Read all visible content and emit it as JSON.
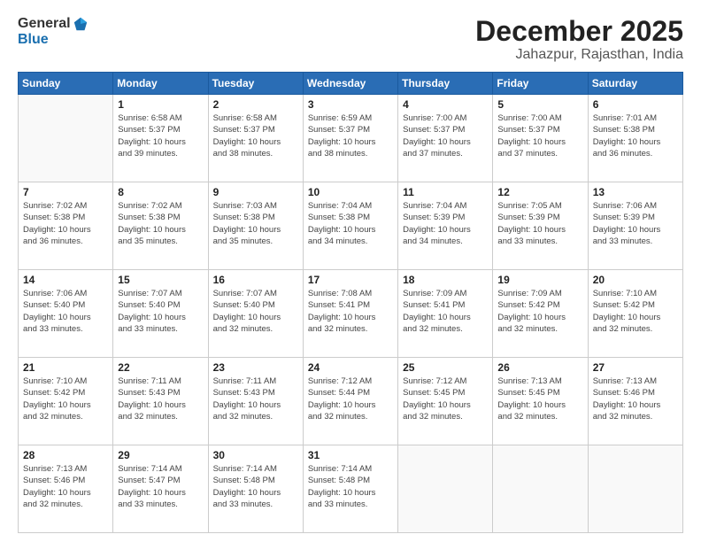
{
  "header": {
    "logo_general": "General",
    "logo_blue": "Blue",
    "month_title": "December 2025",
    "location": "Jahazpur, Rajasthan, India"
  },
  "days_of_week": [
    "Sunday",
    "Monday",
    "Tuesday",
    "Wednesday",
    "Thursday",
    "Friday",
    "Saturday"
  ],
  "weeks": [
    [
      {
        "day": "",
        "info": ""
      },
      {
        "day": "1",
        "info": "Sunrise: 6:58 AM\nSunset: 5:37 PM\nDaylight: 10 hours\nand 39 minutes."
      },
      {
        "day": "2",
        "info": "Sunrise: 6:58 AM\nSunset: 5:37 PM\nDaylight: 10 hours\nand 38 minutes."
      },
      {
        "day": "3",
        "info": "Sunrise: 6:59 AM\nSunset: 5:37 PM\nDaylight: 10 hours\nand 38 minutes."
      },
      {
        "day": "4",
        "info": "Sunrise: 7:00 AM\nSunset: 5:37 PM\nDaylight: 10 hours\nand 37 minutes."
      },
      {
        "day": "5",
        "info": "Sunrise: 7:00 AM\nSunset: 5:37 PM\nDaylight: 10 hours\nand 37 minutes."
      },
      {
        "day": "6",
        "info": "Sunrise: 7:01 AM\nSunset: 5:38 PM\nDaylight: 10 hours\nand 36 minutes."
      }
    ],
    [
      {
        "day": "7",
        "info": "Sunrise: 7:02 AM\nSunset: 5:38 PM\nDaylight: 10 hours\nand 36 minutes."
      },
      {
        "day": "8",
        "info": "Sunrise: 7:02 AM\nSunset: 5:38 PM\nDaylight: 10 hours\nand 35 minutes."
      },
      {
        "day": "9",
        "info": "Sunrise: 7:03 AM\nSunset: 5:38 PM\nDaylight: 10 hours\nand 35 minutes."
      },
      {
        "day": "10",
        "info": "Sunrise: 7:04 AM\nSunset: 5:38 PM\nDaylight: 10 hours\nand 34 minutes."
      },
      {
        "day": "11",
        "info": "Sunrise: 7:04 AM\nSunset: 5:39 PM\nDaylight: 10 hours\nand 34 minutes."
      },
      {
        "day": "12",
        "info": "Sunrise: 7:05 AM\nSunset: 5:39 PM\nDaylight: 10 hours\nand 33 minutes."
      },
      {
        "day": "13",
        "info": "Sunrise: 7:06 AM\nSunset: 5:39 PM\nDaylight: 10 hours\nand 33 minutes."
      }
    ],
    [
      {
        "day": "14",
        "info": "Sunrise: 7:06 AM\nSunset: 5:40 PM\nDaylight: 10 hours\nand 33 minutes."
      },
      {
        "day": "15",
        "info": "Sunrise: 7:07 AM\nSunset: 5:40 PM\nDaylight: 10 hours\nand 33 minutes."
      },
      {
        "day": "16",
        "info": "Sunrise: 7:07 AM\nSunset: 5:40 PM\nDaylight: 10 hours\nand 32 minutes."
      },
      {
        "day": "17",
        "info": "Sunrise: 7:08 AM\nSunset: 5:41 PM\nDaylight: 10 hours\nand 32 minutes."
      },
      {
        "day": "18",
        "info": "Sunrise: 7:09 AM\nSunset: 5:41 PM\nDaylight: 10 hours\nand 32 minutes."
      },
      {
        "day": "19",
        "info": "Sunrise: 7:09 AM\nSunset: 5:42 PM\nDaylight: 10 hours\nand 32 minutes."
      },
      {
        "day": "20",
        "info": "Sunrise: 7:10 AM\nSunset: 5:42 PM\nDaylight: 10 hours\nand 32 minutes."
      }
    ],
    [
      {
        "day": "21",
        "info": "Sunrise: 7:10 AM\nSunset: 5:42 PM\nDaylight: 10 hours\nand 32 minutes."
      },
      {
        "day": "22",
        "info": "Sunrise: 7:11 AM\nSunset: 5:43 PM\nDaylight: 10 hours\nand 32 minutes."
      },
      {
        "day": "23",
        "info": "Sunrise: 7:11 AM\nSunset: 5:43 PM\nDaylight: 10 hours\nand 32 minutes."
      },
      {
        "day": "24",
        "info": "Sunrise: 7:12 AM\nSunset: 5:44 PM\nDaylight: 10 hours\nand 32 minutes."
      },
      {
        "day": "25",
        "info": "Sunrise: 7:12 AM\nSunset: 5:45 PM\nDaylight: 10 hours\nand 32 minutes."
      },
      {
        "day": "26",
        "info": "Sunrise: 7:13 AM\nSunset: 5:45 PM\nDaylight: 10 hours\nand 32 minutes."
      },
      {
        "day": "27",
        "info": "Sunrise: 7:13 AM\nSunset: 5:46 PM\nDaylight: 10 hours\nand 32 minutes."
      }
    ],
    [
      {
        "day": "28",
        "info": "Sunrise: 7:13 AM\nSunset: 5:46 PM\nDaylight: 10 hours\nand 32 minutes."
      },
      {
        "day": "29",
        "info": "Sunrise: 7:14 AM\nSunset: 5:47 PM\nDaylight: 10 hours\nand 33 minutes."
      },
      {
        "day": "30",
        "info": "Sunrise: 7:14 AM\nSunset: 5:48 PM\nDaylight: 10 hours\nand 33 minutes."
      },
      {
        "day": "31",
        "info": "Sunrise: 7:14 AM\nSunset: 5:48 PM\nDaylight: 10 hours\nand 33 minutes."
      },
      {
        "day": "",
        "info": ""
      },
      {
        "day": "",
        "info": ""
      },
      {
        "day": "",
        "info": ""
      }
    ]
  ]
}
